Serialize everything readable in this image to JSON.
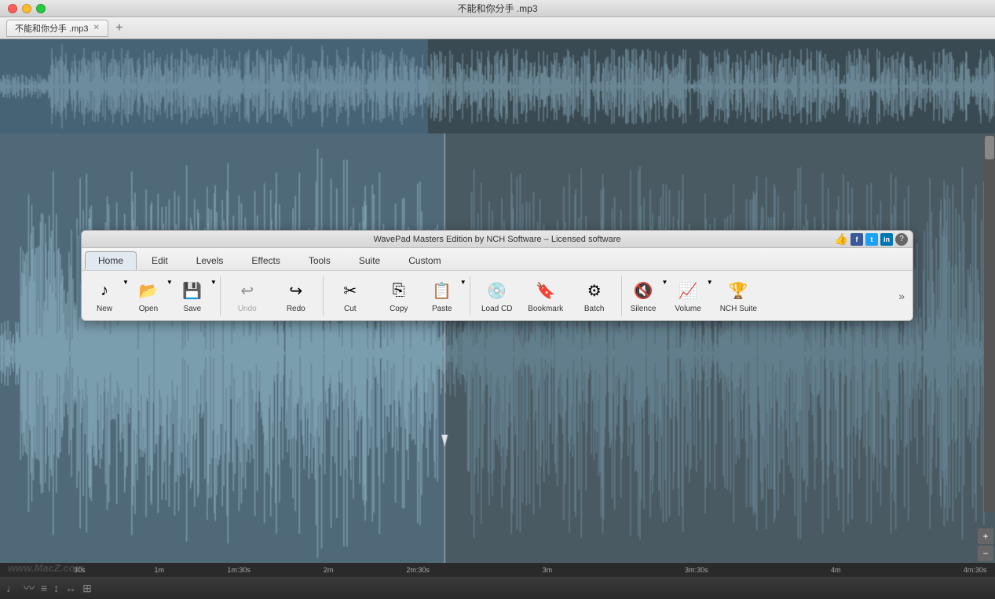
{
  "window": {
    "title": "不能和你分手 .mp3"
  },
  "titlebar": {
    "buttons": {
      "close": "close",
      "minimize": "minimize",
      "maximize": "maximize"
    }
  },
  "tabs": [
    {
      "label": "不能和你分手 .mp3",
      "active": true
    }
  ],
  "tabbar": {
    "add_label": "+"
  },
  "toolbar": {
    "title": "WavePad Masters Edition by NCH Software – Licensed software",
    "menu_tabs": [
      {
        "label": "Home",
        "active": true
      },
      {
        "label": "Edit",
        "active": false
      },
      {
        "label": "Levels",
        "active": false
      },
      {
        "label": "Effects",
        "active": false
      },
      {
        "label": "Tools",
        "active": false
      },
      {
        "label": "Suite",
        "active": false
      },
      {
        "label": "Custom",
        "active": false
      }
    ],
    "buttons": [
      {
        "id": "new",
        "label": "New",
        "icon": "♪",
        "disabled": false,
        "has_dropdown": true
      },
      {
        "id": "open",
        "label": "Open",
        "icon": "📂",
        "disabled": false,
        "has_dropdown": true
      },
      {
        "id": "save",
        "label": "Save",
        "icon": "💾",
        "disabled": false,
        "has_dropdown": true
      },
      {
        "id": "undo",
        "label": "Undo",
        "icon": "↩",
        "disabled": true,
        "has_dropdown": false
      },
      {
        "id": "redo",
        "label": "Redo",
        "icon": "↪",
        "disabled": false,
        "has_dropdown": false
      },
      {
        "id": "cut",
        "label": "Cut",
        "icon": "✂",
        "disabled": false,
        "has_dropdown": false
      },
      {
        "id": "copy",
        "label": "Copy",
        "icon": "⎘",
        "disabled": false,
        "has_dropdown": false
      },
      {
        "id": "paste",
        "label": "Paste",
        "icon": "📋",
        "disabled": false,
        "has_dropdown": true
      },
      {
        "id": "load_cd",
        "label": "Load CD",
        "icon": "💿",
        "disabled": false,
        "has_dropdown": false
      },
      {
        "id": "bookmark",
        "label": "Bookmark",
        "icon": "🔖",
        "disabled": false,
        "has_dropdown": false
      },
      {
        "id": "batch",
        "label": "Batch",
        "icon": "⚙",
        "disabled": false,
        "has_dropdown": false
      },
      {
        "id": "silence",
        "label": "Silence",
        "icon": "🔇",
        "disabled": false,
        "has_dropdown": true
      },
      {
        "id": "volume",
        "label": "Volume",
        "icon": "📈",
        "disabled": false,
        "has_dropdown": true
      },
      {
        "id": "nch_suite",
        "label": "NCH Suite",
        "icon": "🏆",
        "disabled": false,
        "has_dropdown": false
      }
    ],
    "social": {
      "like": "👍",
      "facebook": "f",
      "twitter": "t",
      "linkedin": "in",
      "help": "?"
    }
  },
  "timeline": {
    "ticks": [
      {
        "label": "30s",
        "pct": 8
      },
      {
        "label": "1m",
        "pct": 16
      },
      {
        "label": "1m:30s",
        "pct": 24
      },
      {
        "label": "2m",
        "pct": 33
      },
      {
        "label": "2m:30s",
        "pct": 42
      },
      {
        "label": "3m",
        "pct": 55
      },
      {
        "label": "3m:30s",
        "pct": 70
      },
      {
        "label": "4m",
        "pct": 84
      },
      {
        "label": "4m:30s",
        "pct": 98
      }
    ]
  },
  "statusbar": {
    "icons": [
      "♩",
      "〰",
      "≡",
      "↕",
      "↔",
      "⊞"
    ],
    "watermark": "www.MacZ.com"
  },
  "zoom": {
    "in_label": "+",
    "out_label": "−"
  }
}
